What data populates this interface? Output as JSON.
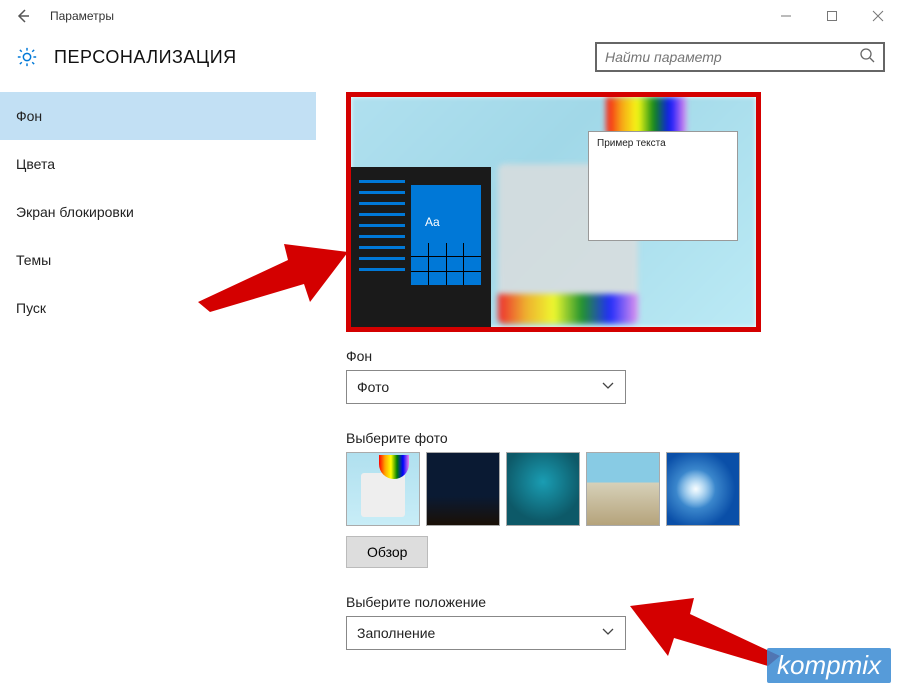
{
  "window": {
    "title": "Параметры"
  },
  "header": {
    "heading": "ПЕРСОНАЛИЗАЦИЯ",
    "search_placeholder": "Найти параметр"
  },
  "sidebar": {
    "items": [
      {
        "label": "Фон",
        "active": true
      },
      {
        "label": "Цвета",
        "active": false
      },
      {
        "label": "Экран блокировки",
        "active": false
      },
      {
        "label": "Темы",
        "active": false
      },
      {
        "label": "Пуск",
        "active": false
      }
    ]
  },
  "content": {
    "preview": {
      "sample_text": "Пример текста",
      "tile_sample": "Aa"
    },
    "background_section": {
      "label": "Фон",
      "dropdown_value": "Фото"
    },
    "choose_photo": {
      "label": "Выберите фото",
      "browse_button": "Обзор"
    },
    "fit_section": {
      "label": "Выберите положение",
      "dropdown_value": "Заполнение"
    }
  },
  "watermark": "kompmix"
}
